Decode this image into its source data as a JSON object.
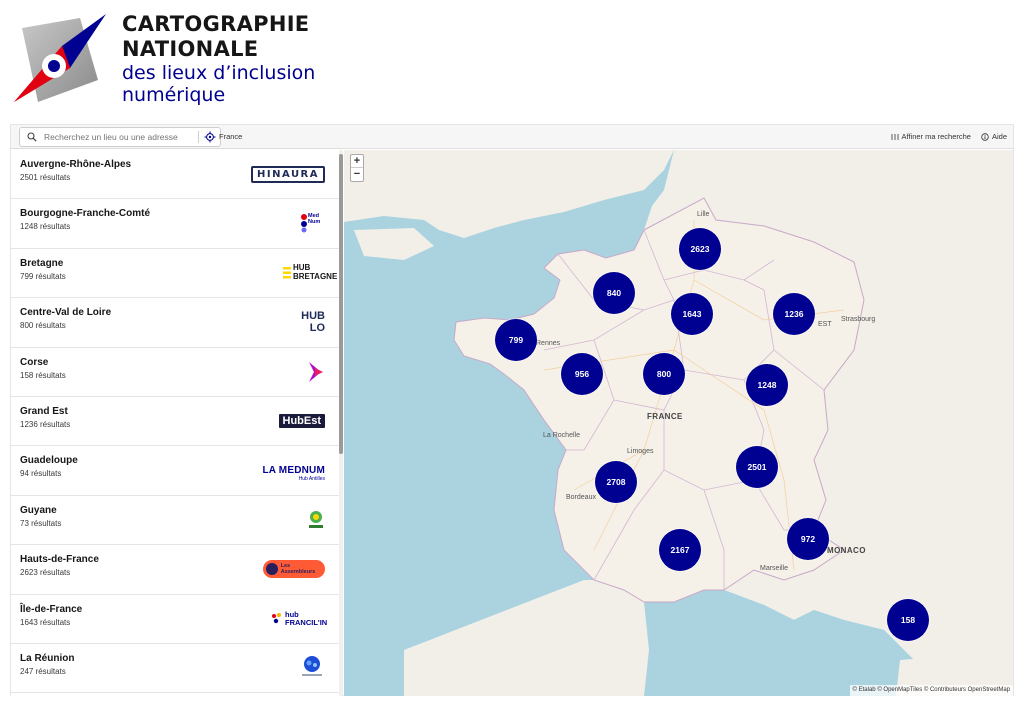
{
  "header": {
    "title_line1": "CARTOGRAPHIE",
    "title_line2": "NATIONALE",
    "subtitle_line1": "des lieux d’inclusion",
    "subtitle_line2": "numérique",
    "logo_icon": "compass-logo-icon",
    "colors": {
      "blue": "#000091",
      "red": "#e1000f"
    }
  },
  "toolbar": {
    "search_placeholder": "Recherchez un lieu ou une adresse",
    "breadcrumb": "France",
    "refine_label": "Affiner ma recherche",
    "help_label": "Aide"
  },
  "regions": [
    {
      "name": "Auvergne-Rhône-Alpes",
      "count": "2501 résultats",
      "logo": "HINAURA"
    },
    {
      "name": "Bourgogne-Franche-Comté",
      "count": "1248 résultats",
      "logo": "Med Num"
    },
    {
      "name": "Bretagne",
      "count": "799 résultats",
      "logo": "HUB BRETAGNE"
    },
    {
      "name": "Centre-Val de Loire",
      "count": "800 résultats",
      "logo": "HUB LO"
    },
    {
      "name": "Corse",
      "count": "158 résultats",
      "logo": ""
    },
    {
      "name": "Grand Est",
      "count": "1236 résultats",
      "logo": "HubEst"
    },
    {
      "name": "Guadeloupe",
      "count": "94 résultats",
      "logo": "LA MEDNUM",
      "logo_sub": "Hub Antilles"
    },
    {
      "name": "Guyane",
      "count": "73 résultats",
      "logo": ""
    },
    {
      "name": "Hauts-de-France",
      "count": "2623 résultats",
      "logo": "Les Assembleurs"
    },
    {
      "name": "Île-de-France",
      "count": "1643 résultats",
      "logo": "hub FRANCIL'IN"
    },
    {
      "name": "La Réunion",
      "count": "247 résultats",
      "logo": ""
    }
  ],
  "map": {
    "zoom_in": "+",
    "zoom_out": "−",
    "clusters": [
      "2623",
      "840",
      "1643",
      "1236",
      "799",
      "956",
      "800",
      "1248",
      "2501",
      "2708",
      "972",
      "2167",
      "158"
    ],
    "labels": {
      "lille": "Lille",
      "rennes": "Rennes",
      "strasbourg": "Strasbourg",
      "france": "FRANCE",
      "la_rochelle": "La Rochelle",
      "limoges": "Limoges",
      "bordeaux": "Bordeaux",
      "monaco": "MONACO",
      "marseille": "Marseille",
      "est": "EST"
    },
    "attribution": "© Etalab © OpenMapTiles © Contributeurs OpenStreetMap"
  }
}
